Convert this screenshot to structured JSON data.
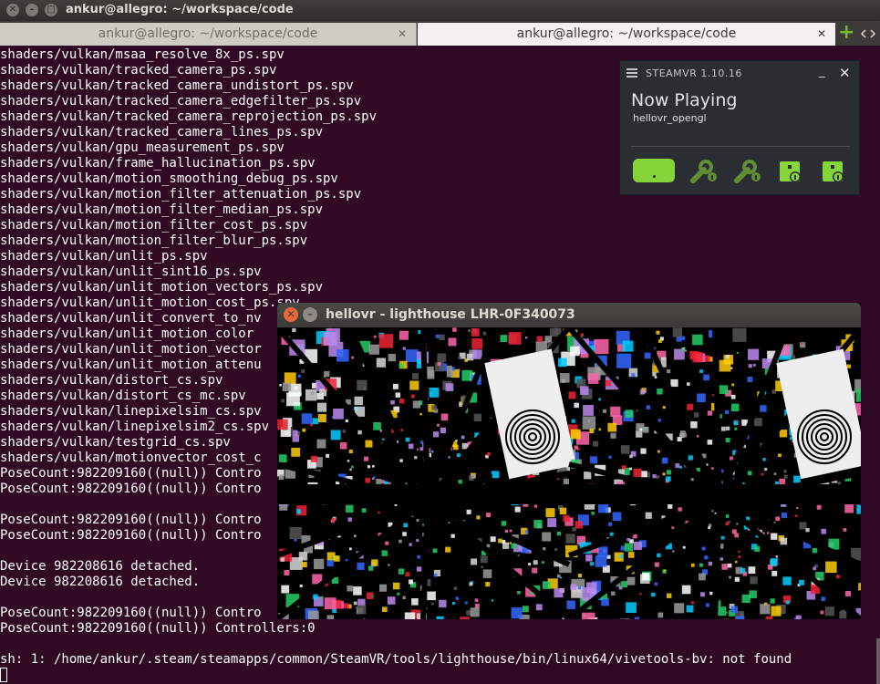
{
  "window": {
    "title": "ankur@allegro: ~/workspace/code",
    "close_glyph": "✕",
    "minimize_glyph": "–",
    "maximize_glyph": "□"
  },
  "tabs": [
    {
      "label": "ankur@allegro: ~/workspace/code",
      "active": false
    },
    {
      "label": "ankur@allegro: ~/workspace/code",
      "active": true
    }
  ],
  "tab_close_glyph": "✕",
  "add_tab_glyph": "+",
  "terminal": {
    "background": "#300a24",
    "lines": [
      "shaders/vulkan/msaa_resolve_8x_ps.spv",
      "shaders/vulkan/tracked_camera_ps.spv",
      "shaders/vulkan/tracked_camera_undistort_ps.spv",
      "shaders/vulkan/tracked_camera_edgefilter_ps.spv",
      "shaders/vulkan/tracked_camera_reprojection_ps.spv",
      "shaders/vulkan/tracked_camera_lines_ps.spv",
      "shaders/vulkan/gpu_measurement_ps.spv",
      "shaders/vulkan/frame_hallucination_ps.spv",
      "shaders/vulkan/motion_smoothing_debug_ps.spv",
      "shaders/vulkan/motion_filter_attenuation_ps.spv",
      "shaders/vulkan/motion_filter_median_ps.spv",
      "shaders/vulkan/motion_filter_cost_ps.spv",
      "shaders/vulkan/motion_filter_blur_ps.spv",
      "shaders/vulkan/unlit_ps.spv",
      "shaders/vulkan/unlit_sint16_ps.spv",
      "shaders/vulkan/unlit_motion_vectors_ps.spv",
      "shaders/vulkan/unlit_motion_cost_ps.spv",
      "shaders/vulkan/unlit_convert_to_nv",
      "shaders/vulkan/unlit_motion_color",
      "shaders/vulkan/unlit_motion_vector",
      "shaders/vulkan/unlit_motion_attenu",
      "shaders/vulkan/distort_cs.spv",
      "shaders/vulkan/distort_cs_mc.spv",
      "shaders/vulkan/linepixelsim_cs.spv",
      "shaders/vulkan/linepixelsim2_cs.spv",
      "shaders/vulkan/testgrid_cs.spv",
      "shaders/vulkan/motionvector_cost_c",
      "PoseCount:982209160((null)) Contro",
      "PoseCount:982209160((null)) Contro",
      "",
      "PoseCount:982209160((null)) Contro",
      "PoseCount:982209160((null)) Contro",
      "",
      "Device 982208616 detached.",
      "Device 982208616 detached.",
      "",
      "PoseCount:982209160((null)) Contro",
      "PoseCount:982209160((null)) Controllers:0",
      "",
      "sh: 1: /home/ankur/.steam/steamapps/common/SteamVR/tools/lighthouse/bin/linux64/vivetools-bv: not found"
    ]
  },
  "steamvr": {
    "title": "STEAMVR 1.10.16",
    "status": "Now Playing",
    "app": "hellovr_opengl",
    "minimize_glyph": "_",
    "close_glyph": "✕",
    "accent": "#84d43a",
    "devices": [
      "hmd-icon",
      "controller-icon",
      "controller-icon",
      "base-station-icon",
      "base-station-icon"
    ]
  },
  "hellovr": {
    "title": "hellovr - lighthouse LHR-0F340073",
    "close_glyph": "✕",
    "minimize_glyph": "–"
  }
}
